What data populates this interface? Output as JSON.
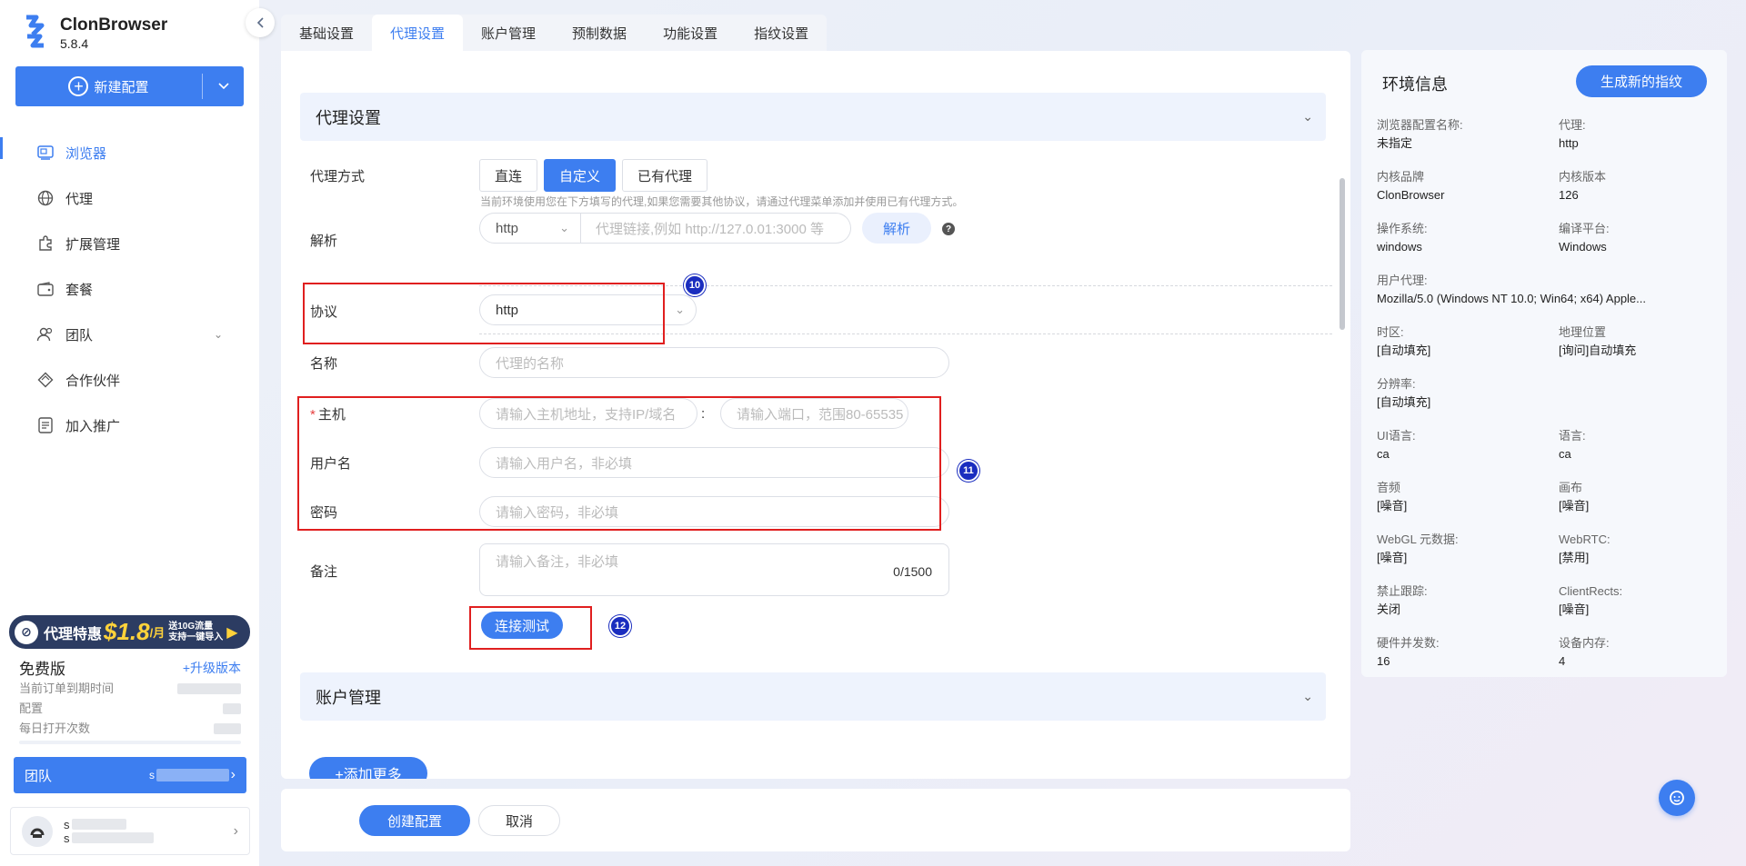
{
  "app": {
    "name": "ClonBrowser",
    "version": "5.8.4"
  },
  "sidebar": {
    "new_config": "新建配置",
    "items": [
      {
        "label": "浏览器",
        "icon": "browser-icon"
      },
      {
        "label": "代理",
        "icon": "globe-icon"
      },
      {
        "label": "扩展管理",
        "icon": "puzzle-icon"
      },
      {
        "label": "套餐",
        "icon": "wallet-icon"
      },
      {
        "label": "团队",
        "icon": "team-icon"
      },
      {
        "label": "合作伙伴",
        "icon": "handshake-icon"
      },
      {
        "label": "加入推广",
        "icon": "promote-icon"
      }
    ],
    "promo": {
      "title": "代理特惠",
      "price": "$1.8",
      "unit": "/月",
      "line1": "送10G流量",
      "line2": "支持一键导入"
    },
    "plan": {
      "name": "免费版",
      "upgrade": "+升级版本",
      "expire_label": "当前订单到期时间",
      "config_label": "配置",
      "daily_label": "每日打开次数"
    },
    "team": {
      "label": "团队",
      "value_prefix": "s"
    },
    "user": {
      "line1_prefix": "s",
      "line2_prefix": "s"
    }
  },
  "tabs": [
    "基础设置",
    "代理设置",
    "账户管理",
    "预制数据",
    "功能设置",
    "指纹设置"
  ],
  "proxy": {
    "section_title": "代理设置",
    "method_label": "代理方式",
    "methods": [
      "直连",
      "自定义",
      "已有代理"
    ],
    "hint": "当前环境使用您在下方填写的代理,如果您需要其他协议，请通过代理菜单添加并使用已有代理方式。",
    "parse_label": "解析",
    "parse_protocol": "http",
    "parse_placeholder": "代理链接,例如 http://127.0.01:3000 等",
    "parse_button": "解析",
    "protocol_label": "协议",
    "protocol_value": "http",
    "name_label": "名称",
    "name_placeholder": "代理的名称",
    "host_label": "主机",
    "host_placeholder": "请输入主机地址，支持IP/域名",
    "port_placeholder": "请输入端口，范围80-65535",
    "username_label": "用户名",
    "username_placeholder": "请输入用户名，非必填",
    "password_label": "密码",
    "password_placeholder": "请输入密码，非必填",
    "remark_label": "备注",
    "remark_placeholder": "请输入备注，非必填",
    "remark_count": "0/1500",
    "test_button": "连接测试",
    "markers": [
      "10",
      "11",
      "12"
    ]
  },
  "account_section_title": "账户管理",
  "add_more": "+添加更多",
  "footer": {
    "create": "创建配置",
    "cancel": "取消"
  },
  "info": {
    "title": "环境信息",
    "generate": "生成新的指纹",
    "rows": [
      [
        {
          "k": "浏览器配置名称:",
          "v": "未指定"
        },
        {
          "k": "代理:",
          "v": "http"
        }
      ],
      [
        {
          "k": "内核品牌",
          "v": "ClonBrowser"
        },
        {
          "k": "内核版本",
          "v": "126"
        }
      ],
      [
        {
          "k": "操作系统:",
          "v": "windows"
        },
        {
          "k": "编译平台:",
          "v": "Windows"
        }
      ],
      [
        {
          "k": "用户代理:",
          "v": "Mozilla/5.0 (Windows NT 10.0; Win64; x64) Apple..."
        }
      ],
      [
        {
          "k": "时区:",
          "v": "[自动填充]"
        },
        {
          "k": "地理位置",
          "v": "[询问]自动填充"
        }
      ],
      [
        {
          "k": "分辨率:",
          "v": "[自动填充]"
        }
      ],
      [
        {
          "k": "UI语言:",
          "v": "ca"
        },
        {
          "k": "语言:",
          "v": "ca"
        }
      ],
      [
        {
          "k": "音频",
          "v": "[噪音]"
        },
        {
          "k": "画布",
          "v": "[噪音]"
        }
      ],
      [
        {
          "k": "WebGL 元数据:",
          "v": "[噪音]"
        },
        {
          "k": "WebRTC:",
          "v": "[禁用]"
        }
      ],
      [
        {
          "k": "禁止跟踪:",
          "v": "关闭"
        },
        {
          "k": "ClientRects:",
          "v": "[噪音]"
        }
      ],
      [
        {
          "k": "硬件并发数:",
          "v": "16"
        },
        {
          "k": "设备内存:",
          "v": "4"
        }
      ]
    ]
  },
  "colors": {
    "primary": "#3d7ef0",
    "annotation_red": "#e01f1f",
    "marker_blue": "#1a2dbf"
  }
}
